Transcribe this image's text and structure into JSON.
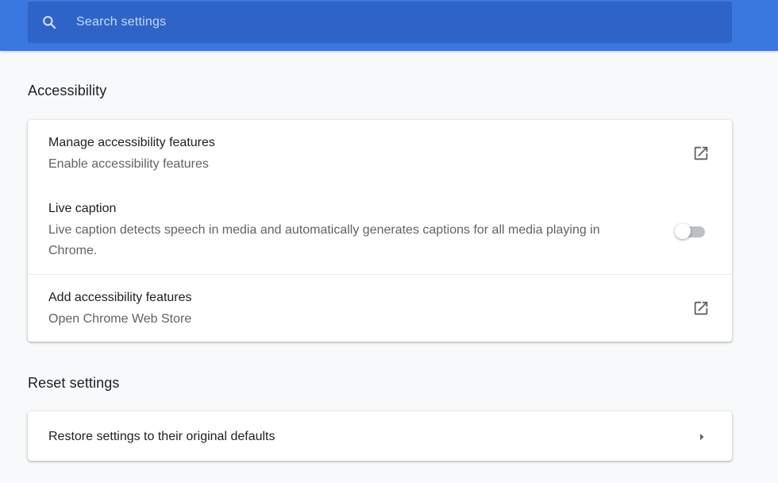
{
  "search": {
    "placeholder": "Search settings",
    "icon": "search-icon"
  },
  "accessibility": {
    "title": "Accessibility",
    "rows": [
      {
        "title": "Manage accessibility features",
        "subtitle": "Enable accessibility features",
        "icon": "open-in-new-icon"
      },
      {
        "title": "Live caption",
        "subtitle_line1": "Live caption detects speech in media and automatically generates captions for all media playing in",
        "subtitle_line2": "Chrome.",
        "toggle_on": false
      },
      {
        "title": "Add accessibility features",
        "subtitle": "Open Chrome Web Store",
        "icon": "open-in-new-icon"
      }
    ]
  },
  "reset": {
    "title": "Reset settings",
    "rows": [
      {
        "title": "Restore settings to their original defaults",
        "icon": "chevron-right-icon"
      }
    ]
  },
  "colors": {
    "header_bg": "#3a78e0",
    "search_bg": "#2e64c7",
    "page_bg": "#f8f9fa",
    "secondary_text": "#5f6368",
    "icon_color": "#5f6368"
  }
}
